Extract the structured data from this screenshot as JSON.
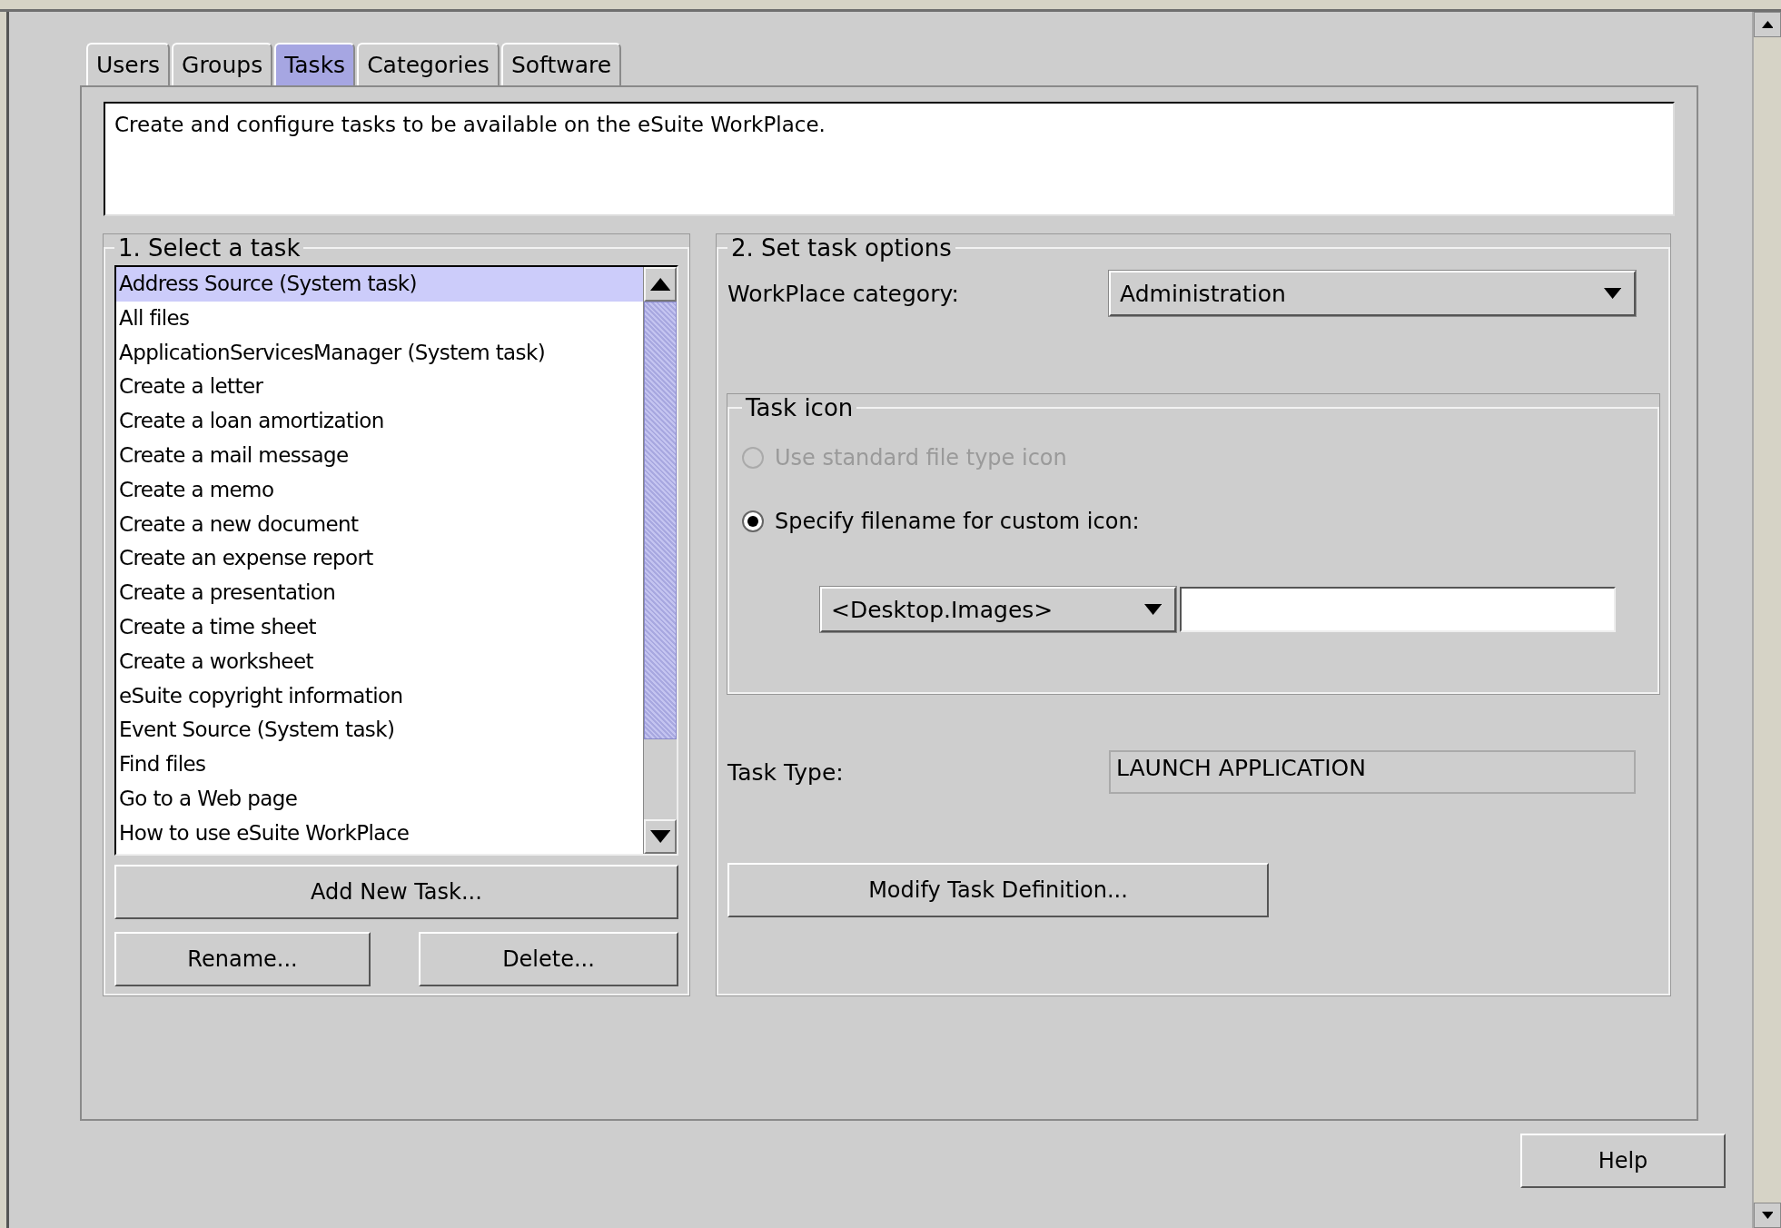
{
  "tabs": [
    {
      "label": "Users",
      "selected": false
    },
    {
      "label": "Groups",
      "selected": false
    },
    {
      "label": "Tasks",
      "selected": true
    },
    {
      "label": "Categories",
      "selected": false
    },
    {
      "label": "Software",
      "selected": false
    }
  ],
  "description": "Create and configure tasks to be available on the eSuite WorkPlace.",
  "task_group": {
    "title": "1. Select a task",
    "tasks": [
      {
        "label": "Address Source (System task)",
        "selected": true
      },
      {
        "label": "All files",
        "selected": false
      },
      {
        "label": "ApplicationServicesManager (System task)",
        "selected": false
      },
      {
        "label": "Create a letter",
        "selected": false
      },
      {
        "label": "Create a loan amortization",
        "selected": false
      },
      {
        "label": "Create a mail message",
        "selected": false
      },
      {
        "label": "Create a memo",
        "selected": false
      },
      {
        "label": "Create a new document",
        "selected": false
      },
      {
        "label": "Create an expense report",
        "selected": false
      },
      {
        "label": "Create a presentation",
        "selected": false
      },
      {
        "label": "Create a time sheet",
        "selected": false
      },
      {
        "label": "Create a worksheet",
        "selected": false
      },
      {
        "label": "eSuite copyright information",
        "selected": false
      },
      {
        "label": "Event Source (System task)",
        "selected": false
      },
      {
        "label": "Find files",
        "selected": false
      },
      {
        "label": "Go to a Web page",
        "selected": false
      },
      {
        "label": "How to use eSuite WorkPlace",
        "selected": false
      }
    ],
    "add_button": "Add New Task...",
    "rename_button": "Rename...",
    "delete_button": "Delete..."
  },
  "options_group": {
    "title": "2. Set task options",
    "category": {
      "label": "WorkPlace category:",
      "value": "Administration"
    },
    "task_icon": {
      "title": "Task icon",
      "options": [
        {
          "label": "Use standard file type icon",
          "selected": false,
          "disabled": true
        },
        {
          "label": "Specify filename for custom icon:",
          "selected": true,
          "disabled": false
        }
      ],
      "folder": "<Desktop.Images>"
    },
    "task_type": {
      "label": "Task Type:",
      "value": "LAUNCH APPLICATION"
    },
    "modify_button": "Modify Task Definition..."
  },
  "help_button": "Help"
}
